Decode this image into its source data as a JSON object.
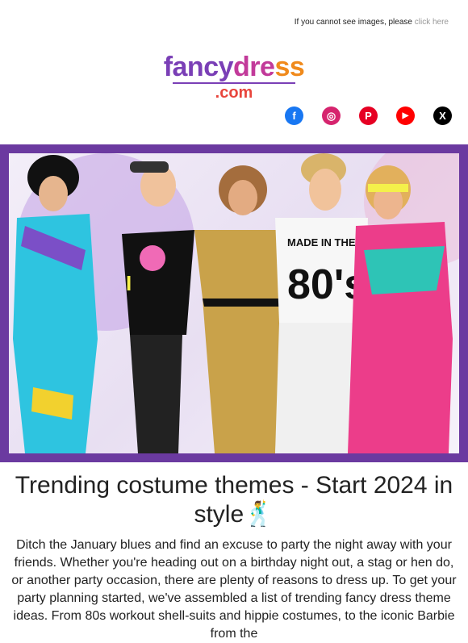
{
  "header": {
    "note_text": "If you cannot see images, please ",
    "note_link": "click here"
  },
  "logo": {
    "part1": "fancy",
    "part2": "dre",
    "part3": "ss",
    "sub": ".com"
  },
  "social": [
    {
      "name": "facebook",
      "glyph": "f"
    },
    {
      "name": "instagram",
      "glyph": "◎"
    },
    {
      "name": "pinterest",
      "glyph": "P"
    },
    {
      "name": "youtube",
      "glyph": "▶"
    },
    {
      "name": "x",
      "glyph": "X"
    }
  ],
  "hero": {
    "shirt_text_1": "MADE IN THE",
    "shirt_text_2": "80's"
  },
  "article": {
    "title": "Trending costume themes - Start 2024 in style🕺",
    "body": "Ditch the January blues and find an excuse to party the night away with your friends. Whether you're heading out on a birthday night out, a stag or hen do, or another party occasion, there are plenty of reasons to dress up. To get your party planning started, we've assembled a list of trending fancy dress theme ideas. From 80s workout shell-suits and hippie costumes, to the iconic Barbie from the"
  }
}
